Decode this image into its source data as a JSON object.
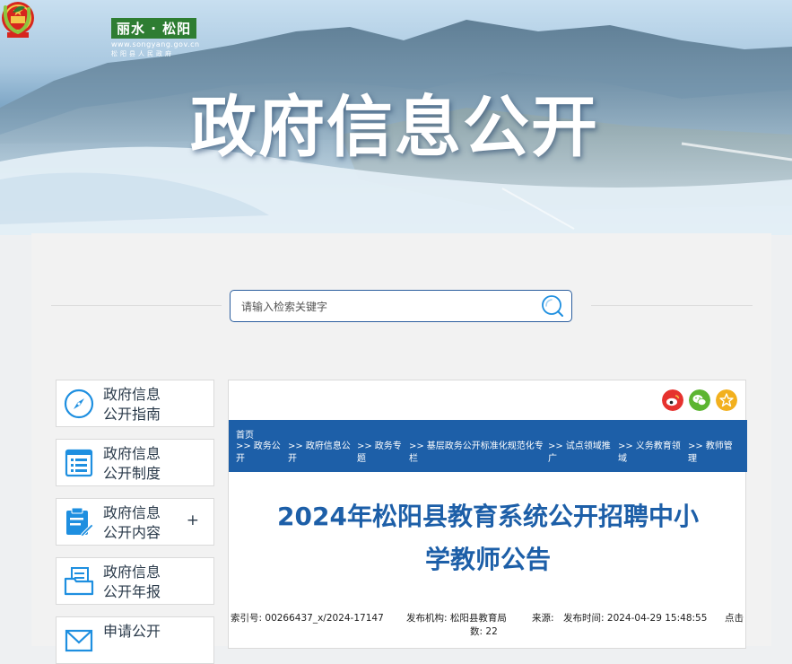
{
  "header": {
    "logo_cn": "丽水 · 松阳",
    "logo_url": "www.songyang.gov.cn",
    "logo_sub": "松阳县人民政府",
    "banner_title": "政府信息公开"
  },
  "search": {
    "placeholder": "请输入检索关键字"
  },
  "sidebar": {
    "items": [
      {
        "line1": "政府信息",
        "line2": "公开指南",
        "icon": "compass-icon"
      },
      {
        "line1": "政府信息",
        "line2": "公开制度",
        "icon": "list-document-icon"
      },
      {
        "line1": "政府信息",
        "line2": "公开内容",
        "icon": "edit-document-icon",
        "expand": "+"
      },
      {
        "line1": "政府信息",
        "line2": "公开年报",
        "icon": "folder-document-icon"
      },
      {
        "line1": "申请公开",
        "line2": "",
        "icon": "mail-icon"
      }
    ]
  },
  "share": {
    "weibo": "weibo-icon",
    "wechat": "wechat-icon",
    "favorite": "star-icon"
  },
  "breadcrumb": {
    "home": "首页",
    "sep": ">>",
    "items": [
      {
        "l1": "政务公",
        "l2": "开"
      },
      {
        "l1": "政府信息公",
        "l2": "开"
      },
      {
        "l1": "政务专",
        "l2": "题"
      },
      {
        "l1": "基层政务公开标准化规范化专",
        "l2": "栏"
      },
      {
        "l1": "试点领域推",
        "l2": "广"
      },
      {
        "l1": "义务教育领",
        "l2": "域"
      },
      {
        "l1": "教师管",
        "l2": "理"
      }
    ]
  },
  "article": {
    "title_line1": "2024年松阳县教育系统公开招聘中小",
    "title_line2": "学教师公告",
    "meta": {
      "index_label": "索引号:",
      "index_value": "00266437_x/2024-17147",
      "org_label": "发布机构:",
      "org_value": "松阳县教育局",
      "source_label": "来源:",
      "date_label": "发布时间:",
      "date_value": "2024-04-29 15:48:55",
      "hits_label1": "点击",
      "hits_label2": "数:",
      "hits_value": "22"
    }
  },
  "colors": {
    "accent_blue": "#1d5fa8",
    "icon_blue": "#1e8fe0",
    "weibo_red": "#e6322e",
    "wechat_green": "#5cb531",
    "star_yellow": "#f2b01e"
  }
}
